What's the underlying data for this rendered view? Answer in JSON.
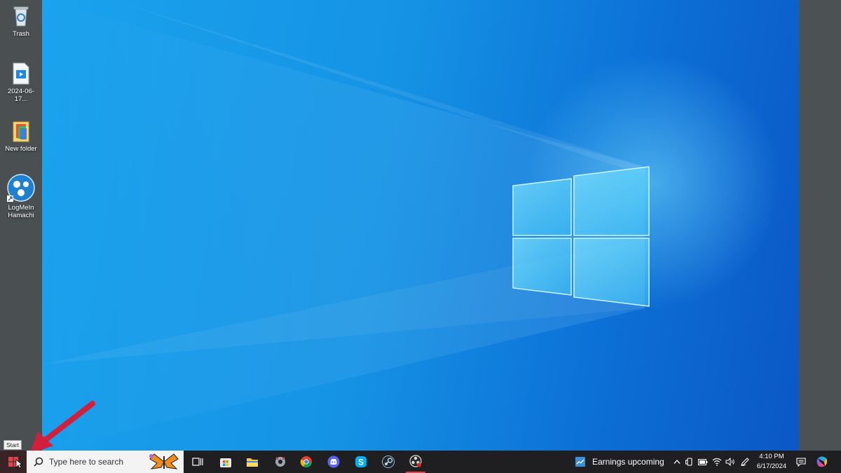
{
  "desktop": {
    "icons": [
      {
        "label": "Trash",
        "icon": "recycle-bin-icon"
      },
      {
        "label": "2024-06-17...",
        "icon": "video-file-icon"
      },
      {
        "label": "New folder",
        "icon": "folder-icon"
      },
      {
        "label": "LogMeIn Hamachi",
        "icon": "hamachi-icon"
      }
    ],
    "start_tooltip": "Start"
  },
  "taskbar": {
    "search_placeholder": "Type here to search",
    "apps": [
      "task-view-icon",
      "microsoft-store-icon",
      "file-explorer-icon",
      "gear-app-icon",
      "chrome-icon",
      "discord-icon",
      "skype-icon",
      "steam-icon",
      "obs-icon"
    ],
    "widget_text": "Earnings upcoming",
    "clock_time": "4:10 PM",
    "clock_date": "6/17/2024"
  },
  "colors": {
    "wallpaper": "#1592e4",
    "taskbar": "#1f1f22",
    "annotation_arrow": "#d21f3c"
  }
}
